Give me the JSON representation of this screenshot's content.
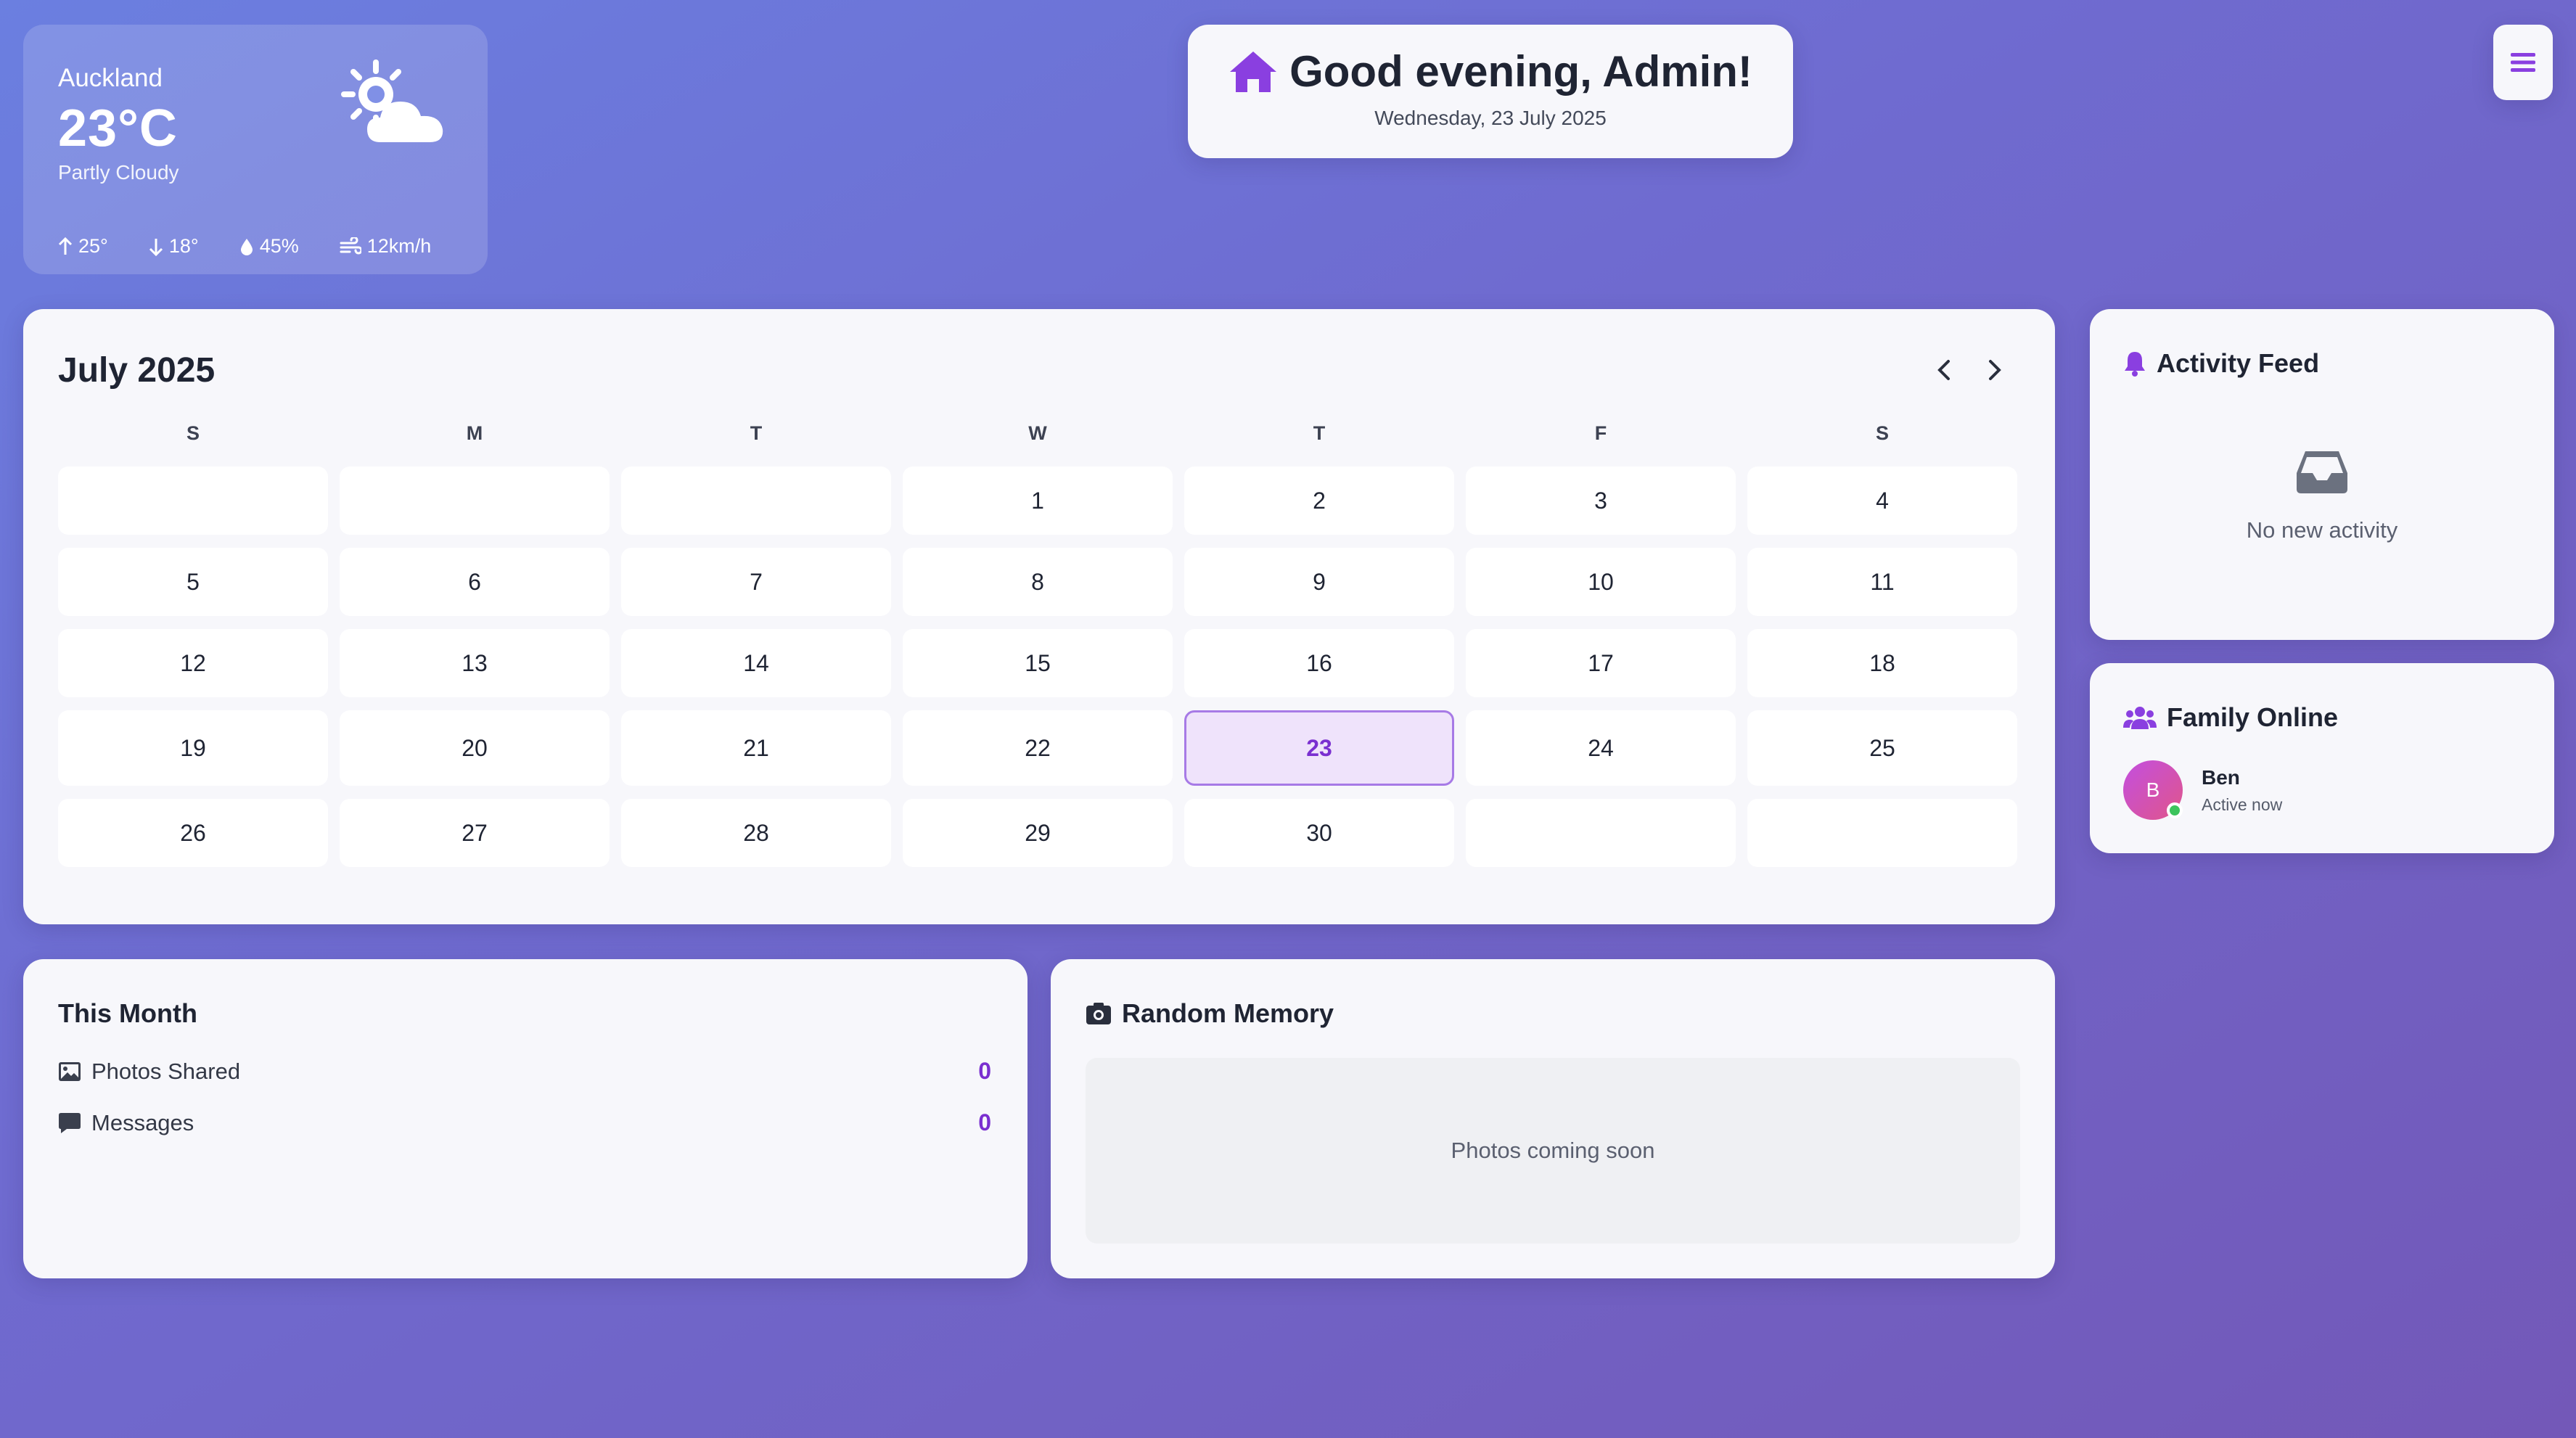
{
  "weather": {
    "city": "Auckland",
    "temp": "23°C",
    "condition": "Partly Cloudy",
    "high": "25°",
    "low": "18°",
    "humidity": "45%",
    "wind": "12km/h",
    "icon": "sun-cloud-icon"
  },
  "greeting": {
    "title": "Good evening, Admin!",
    "date": "Wednesday, 23 July 2025",
    "icon": "home-icon"
  },
  "menu": {
    "icon": "hamburger-menu-icon"
  },
  "calendar": {
    "title": "July 2025",
    "weekdays": [
      "S",
      "M",
      "T",
      "W",
      "T",
      "F",
      "S"
    ],
    "days": [
      "",
      "",
      "",
      "1",
      "2",
      "3",
      "4",
      "5",
      "6",
      "7",
      "8",
      "9",
      "10",
      "11",
      "12",
      "13",
      "14",
      "15",
      "16",
      "17",
      "18",
      "19",
      "20",
      "21",
      "22",
      "23",
      "24",
      "25",
      "26",
      "27",
      "28",
      "29",
      "30",
      "",
      ""
    ],
    "today": "23"
  },
  "activity": {
    "title": "Activity Feed",
    "empty_text": "No new activity"
  },
  "family": {
    "title": "Family Online",
    "members": [
      {
        "initial": "B",
        "name": "Ben",
        "status": "Active now"
      }
    ]
  },
  "this_month": {
    "title": "This Month",
    "stats": [
      {
        "label": "Photos Shared",
        "value": "0",
        "icon": "image-icon"
      },
      {
        "label": "Messages",
        "value": "0",
        "icon": "message-icon"
      }
    ]
  },
  "memory": {
    "title": "Random Memory",
    "placeholder": "Photos coming soon"
  },
  "colors": {
    "accent": "#7a2fd0",
    "online": "#3cc45c"
  }
}
